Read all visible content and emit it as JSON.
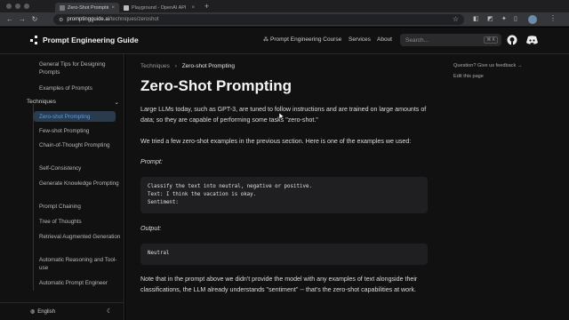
{
  "browser": {
    "tabs": [
      {
        "label": "Zero-Shot Prompting | Prom",
        "active": true
      },
      {
        "label": "Playground - OpenAI API",
        "active": false
      }
    ],
    "url_host": "promptingguide.ai",
    "url_path": "/techniques/zeroshot"
  },
  "header": {
    "site_title": "Prompt Engineering Guide",
    "nav": [
      "Prompt Engineering Course",
      "Services",
      "About"
    ],
    "search_placeholder": "Search...",
    "search_shortcut": "⌘ K"
  },
  "sidebar": {
    "top_items": [
      "General Tips for Designing Prompts",
      "Examples of Prompts"
    ],
    "section_label": "Techniques",
    "items": [
      "Zero-shot Prompting",
      "Few-shot Prompting",
      "Chain-of-Thought Prompting",
      "Self-Consistency",
      "Generate Knowledge Prompting",
      "Prompt Chaining",
      "Tree of Thoughts",
      "Retrieval Augmented Generation",
      "Automatic Reasoning and Tool-use",
      "Automatic Prompt Engineer"
    ],
    "active_index": 0,
    "language": "English"
  },
  "main": {
    "breadcrumb_parent": "Techniques",
    "breadcrumb_current": "Zero-shot Prompting",
    "title": "Zero-Shot Prompting",
    "paragraph_1": "Large LLMs today, such as GPT-3, are tuned to follow instructions and are trained on large amounts of data; so they are capable of performing some tasks \"zero-shot.\"",
    "paragraph_2": "We tried a few zero-shot examples in the previous section. Here is one of the examples we used:",
    "prompt_label": "Prompt:",
    "prompt_code": "Classify the text into neutral, negative or positive.\nText: I think the vacation is okay.\nSentiment:",
    "output_label": "Output:",
    "output_code": "Neutral",
    "paragraph_3": "Note that in the prompt above we didn't provide the model with any examples of text alongside their classifications, the LLM already understands \"sentiment\" -- that's the zero-shot capabilities at work."
  },
  "right_rail": {
    "feedback": "Question? Give us feedback →",
    "edit": "Edit this page"
  },
  "colors": {
    "accent": "#4ea1f5",
    "background": "#111112",
    "active_bg": "#2b3b4e"
  }
}
